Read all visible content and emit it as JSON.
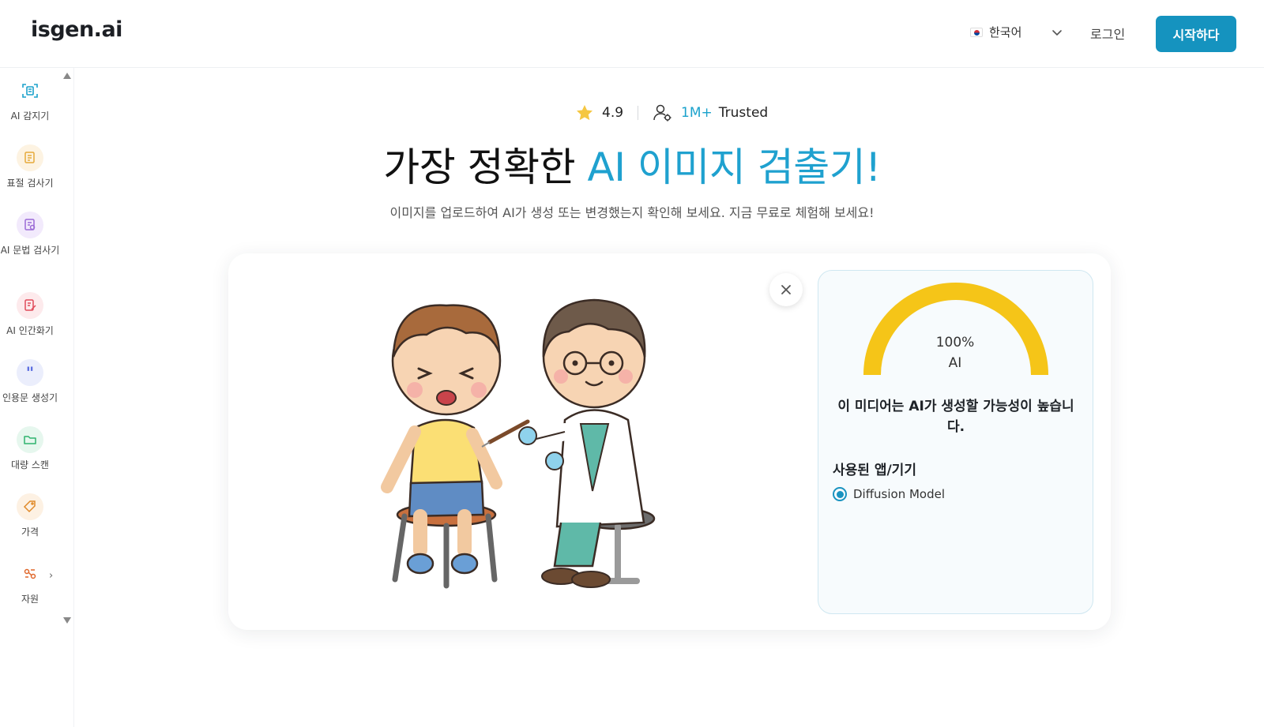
{
  "header": {
    "logo": "isgen.ai",
    "language": "한국어",
    "login": "로그인",
    "start": "시작하다"
  },
  "sidebar": {
    "items": [
      {
        "label": "AI 감지기",
        "icon": "ai-scan-icon",
        "color": "#1ba2cc"
      },
      {
        "label": "표절 검사기",
        "icon": "document-check-icon",
        "color": "#e6a93a"
      },
      {
        "label": "AI 문법 검사기",
        "icon": "grammar-check-icon",
        "color": "#9b6bd6"
      },
      {
        "label": "AI 인간화기",
        "icon": "humanizer-icon",
        "color": "#e04a5a"
      },
      {
        "label": "인용문 생성기",
        "icon": "quote-icon",
        "color": "#5b6ee1"
      },
      {
        "label": "대량 스캔",
        "icon": "folder-icon",
        "color": "#2fb46e"
      },
      {
        "label": "가격",
        "icon": "price-tag-icon",
        "color": "#e08a2a"
      },
      {
        "label": "자원",
        "icon": "resources-icon",
        "color": "#e0672a"
      }
    ]
  },
  "hero": {
    "rating": "4.9",
    "users": "1M+",
    "trusted": "Trusted",
    "title_main": "가장 정확한 ",
    "title_accent": "AI 이미지 검출기!",
    "subtitle": "이미지를 업로드하여 AI가 생성 또는 변경했는지 확인해 보세요. 지금 무료로 체험해 보세요!"
  },
  "result": {
    "percent": "100%",
    "percent_value": 100,
    "label": "AI",
    "verdict": "이 미디어는 AI가 생성할 가능성이 높습니다.",
    "used_title": "사용된 앱/기기",
    "model": "Diffusion Model",
    "gauge_color": "#f5c518"
  }
}
